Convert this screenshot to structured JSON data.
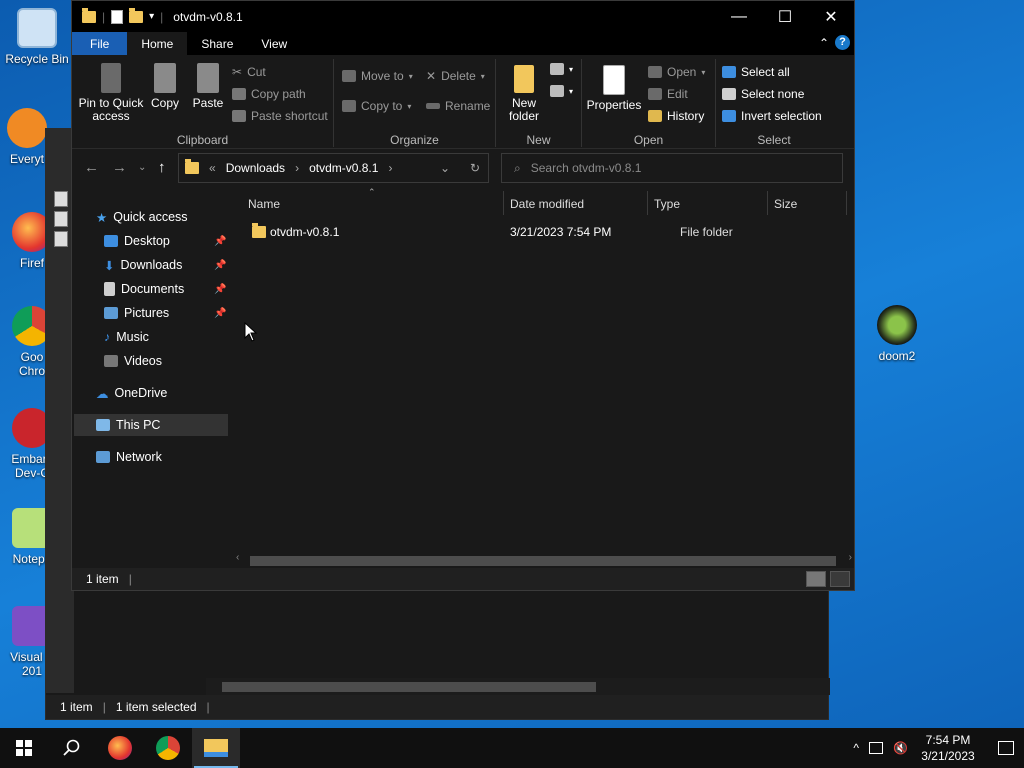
{
  "desktop": {
    "icons": [
      "Recycle Bin",
      "Everyt",
      "Firef",
      "Goo",
      "Chro",
      "Embarc",
      "Dev-C",
      "Notepa",
      "Visual S",
      "201",
      "doom2"
    ]
  },
  "window": {
    "title": "otvdm-v0.8.1",
    "controls": {
      "minimize": "—",
      "maximize": "☐",
      "close": "✕"
    },
    "tabs": [
      "File",
      "Home",
      "Share",
      "View"
    ],
    "help": "?"
  },
  "ribbon": {
    "clipboard": {
      "label": "Clipboard",
      "pin": "Pin to Quick access",
      "copy": "Copy",
      "paste": "Paste",
      "cut": "Cut",
      "copy_path": "Copy path",
      "paste_shortcut": "Paste shortcut"
    },
    "organize": {
      "label": "Organize",
      "move_to": "Move to",
      "copy_to": "Copy to",
      "delete": "Delete",
      "rename": "Rename"
    },
    "new": {
      "label": "New",
      "new_folder": "New folder"
    },
    "open": {
      "label": "Open",
      "properties": "Properties",
      "open": "Open",
      "edit": "Edit",
      "history": "History"
    },
    "select": {
      "label": "Select",
      "select_all": "Select all",
      "select_none": "Select none",
      "invert": "Invert selection"
    }
  },
  "address": {
    "crumbs_prefix": "«",
    "crumb1": "Downloads",
    "crumb2": "otvdm-v0.8.1",
    "search_placeholder": "Search otvdm-v0.8.1"
  },
  "nav": {
    "quick_access": "Quick access",
    "desktop": "Desktop",
    "downloads": "Downloads",
    "documents": "Documents",
    "pictures": "Pictures",
    "music": "Music",
    "videos": "Videos",
    "onedrive": "OneDrive",
    "thispc": "This PC",
    "network": "Network"
  },
  "columns": {
    "name": "Name",
    "date": "Date modified",
    "type": "Type",
    "size": "Size"
  },
  "files": [
    {
      "name": "otvdm-v0.8.1",
      "date": "3/21/2023 7:54 PM",
      "type": "File folder",
      "size": ""
    }
  ],
  "status": {
    "count": "1 item"
  },
  "bg_status": {
    "count": "1 item",
    "selected": "1 item selected"
  },
  "taskbar": {
    "time": "7:54 PM",
    "date": "3/21/2023"
  }
}
